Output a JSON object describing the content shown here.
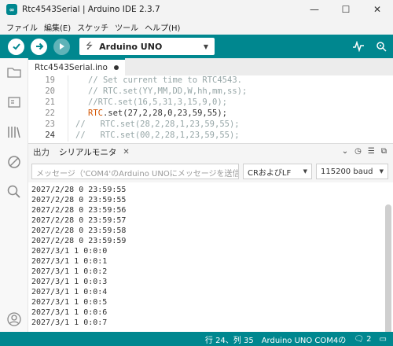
{
  "window": {
    "title": "Rtc4543Serial | Arduino IDE 2.3.7",
    "minimize": "—",
    "maximize": "☐",
    "close": "✕"
  },
  "menu": [
    "ファイル",
    "編集(E)",
    "スケッチ",
    "ツール",
    "ヘルプ(H)"
  ],
  "toolbar": {
    "board": "Arduino UNO"
  },
  "editor": {
    "tab": "Rtc4543Serial.ino",
    "lines": [
      {
        "num": "19",
        "text": "// Set current time to RTC4543."
      },
      {
        "num": "20",
        "text": "// RTC.set(YY,MM,DD,W,hh,mm,ss);"
      },
      {
        "num": "21",
        "text": "//RTC.set(16,5,31,3,15,9,0);"
      },
      {
        "num": "22",
        "func": "RTC",
        "rest": ".set(27,2,28,0,23,59,55);"
      },
      {
        "num": "23",
        "text": "//   RTC.set(28,2,28,1,23,59,55);"
      },
      {
        "num": "24",
        "text": "//   RTC.set(00,2,28,1,23,59,55);"
      }
    ]
  },
  "panel": {
    "tab_output": "出力",
    "tab_serial": "シリアルモニタ",
    "close": "✕",
    "message_placeholder": "メッセージ（'COM4'のArduino UNOにメッセージを送信...",
    "line_ending": "CRおよびLF",
    "baud": "115200 baud",
    "serial_lines": [
      "2027/2/28 0 23:59:55",
      "2027/2/28 0 23:59:55",
      "2027/2/28 0 23:59:56",
      "2027/2/28 0 23:59:57",
      "2027/2/28 0 23:59:58",
      "2027/2/28 0 23:59:59",
      "2027/3/1 1 0:0:0",
      "2027/3/1 1 0:0:1",
      "2027/3/1 1 0:0:2",
      "2027/3/1 1 0:0:3",
      "2027/3/1 1 0:0:4",
      "2027/3/1 1 0:0:5",
      "2027/3/1 1 0:0:6",
      "2027/3/1 1 0:0:7"
    ]
  },
  "status": {
    "position": "行 24、列 35",
    "board_port": "Arduino UNO COM4の",
    "notifications": "2"
  },
  "colors": {
    "accent": "#00878f",
    "comment": "#95a5a6",
    "function": "#d35400"
  }
}
